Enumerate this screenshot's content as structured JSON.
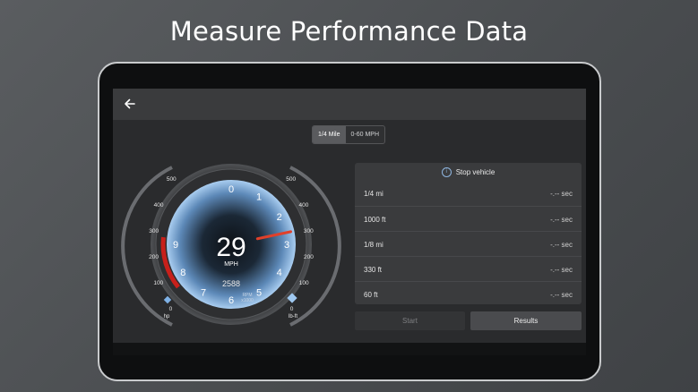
{
  "headline": "Measure Performance Data",
  "app": {
    "back_icon": "arrow-left-icon"
  },
  "mode_tabs": {
    "items": [
      "1/4 Mile",
      "0-60 MPH"
    ],
    "selected": "1/4 Mile"
  },
  "gauge": {
    "speed": "29",
    "speed_unit": "MPH",
    "rpm_value": "2588",
    "rpm_unit": "RPM",
    "rpm_scale": "x1000",
    "dial_ticks": [
      "0",
      "1",
      "2",
      "3",
      "4",
      "5",
      "6",
      "7",
      "8",
      "9"
    ],
    "needle_rpm_x1000": 2.6,
    "hp_scale": [
      "0",
      "100",
      "200",
      "300",
      "400",
      "500"
    ],
    "hp_unit": "hp",
    "torque_scale": [
      "0",
      "100",
      "200",
      "300",
      "400",
      "500"
    ],
    "torque_unit": "lb-ft",
    "redline_start": 8
  },
  "results_panel": {
    "status": "Stop vehicle",
    "rows": [
      {
        "label": "1/4 mi",
        "value": "-.-- sec"
      },
      {
        "label": "1000 ft",
        "value": "-.-- sec"
      },
      {
        "label": "1/8 mi",
        "value": "-.-- sec"
      },
      {
        "label": "330 ft",
        "value": "-.-- sec"
      },
      {
        "label": "60 ft",
        "value": "-.-- sec"
      }
    ]
  },
  "buttons": {
    "start": "Start",
    "results": "Results"
  },
  "colors": {
    "accent_blue": "#7fb2e6",
    "needle_red": "#e0402a"
  }
}
